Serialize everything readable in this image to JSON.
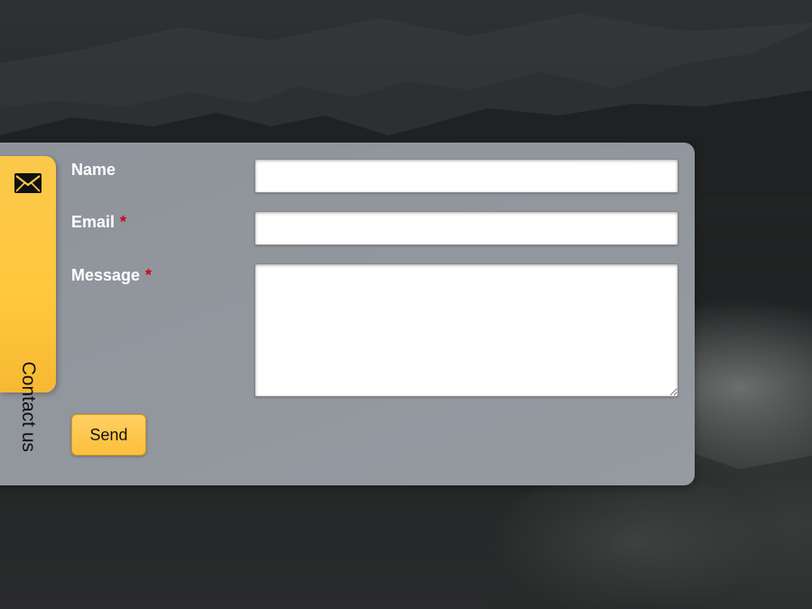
{
  "tab": {
    "label": "Contact us",
    "icon": "envelope-icon",
    "color": "#ffc83c"
  },
  "form": {
    "name_label": "Name",
    "email_label": "Email",
    "message_label": "Message",
    "required_marker": "*",
    "name_value": "",
    "email_value": "",
    "message_value": "",
    "send_label": "Send"
  },
  "colors": {
    "panel": "#92979e",
    "accent": "#ffc83c",
    "required": "#d0021b"
  }
}
